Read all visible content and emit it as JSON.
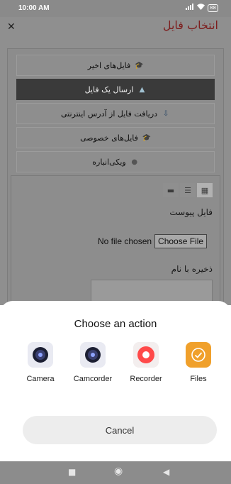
{
  "status": {
    "time": "10:00 AM",
    "signal_icon": "signal-icon",
    "wifi_icon": "wifi-icon",
    "battery_label": "88"
  },
  "page": {
    "title": "انتخاب فایل",
    "menu": [
      {
        "label": "فایل‌های اخیر",
        "icon": "recent-files-icon"
      },
      {
        "label": "ارسال یک فایل",
        "icon": "upload-icon",
        "active": true
      },
      {
        "label": "دریافت فایل از آدرس اینترنتی",
        "icon": "download-url-icon"
      },
      {
        "label": "فایل‌های خصوصی",
        "icon": "private-files-icon"
      },
      {
        "label": "ویکی‌انباره",
        "icon": "wikimedia-icon"
      }
    ],
    "attachment_label": "فایل پیوست",
    "no_file_text": "No file chosen",
    "choose_file_label": "Choose File",
    "save_as_label": "ذخیره با نام"
  },
  "sheet": {
    "heading": "Choose an action",
    "actions": [
      {
        "label": "Camera",
        "icon": "camera-icon"
      },
      {
        "label": "Camcorder",
        "icon": "camcorder-icon"
      },
      {
        "label": "Recorder",
        "icon": "recorder-icon"
      },
      {
        "label": "Files",
        "icon": "files-icon"
      }
    ],
    "cancel_label": "Cancel"
  },
  "colors": {
    "files_accent": "#f0a02b",
    "recorder_accent": "#ff4a4a",
    "title_color": "#b52a2a"
  }
}
